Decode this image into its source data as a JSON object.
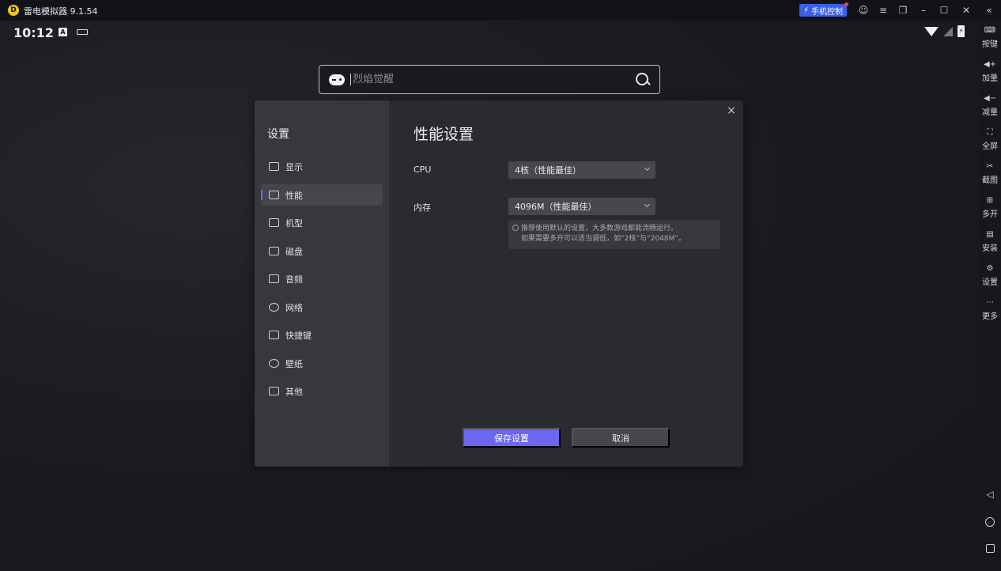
{
  "titlebar": {
    "app_title": "雷电模拟器 9.1.54",
    "logo_glyph": "D",
    "phone_control": "手机控制",
    "icons": [
      "user-icon",
      "menu-icon",
      "restore-icon",
      "minimize-icon",
      "maximize-icon",
      "close-icon",
      "collapse-icon"
    ]
  },
  "status": {
    "time": "10:12",
    "a_badge": "A",
    "battery_glyph": "⚡"
  },
  "search": {
    "placeholder": "烈焰觉醒"
  },
  "toolbar": {
    "items": [
      {
        "label": "按键",
        "icon": "keyboard-icon",
        "glyph": "⌨"
      },
      {
        "label": "加量",
        "icon": "volume-up-icon",
        "glyph": "◀+"
      },
      {
        "label": "减量",
        "icon": "volume-down-icon",
        "glyph": "◀−"
      },
      {
        "label": "全屏",
        "icon": "fullscreen-icon",
        "glyph": "⛶"
      },
      {
        "label": "截图",
        "icon": "screenshot-icon",
        "glyph": "✂"
      },
      {
        "label": "多开",
        "icon": "multi-instance-icon",
        "glyph": "⊞"
      },
      {
        "label": "安装",
        "icon": "install-icon",
        "glyph": "▤"
      },
      {
        "label": "设置",
        "icon": "settings-icon",
        "glyph": "⚙"
      },
      {
        "label": "更多",
        "icon": "more-icon",
        "glyph": "⋯"
      }
    ]
  },
  "dialog": {
    "heading": "设置",
    "title": "性能设置",
    "menu": [
      {
        "label": "显示",
        "icon": "display-icon",
        "active": false
      },
      {
        "label": "性能",
        "icon": "performance-icon",
        "active": true
      },
      {
        "label": "机型",
        "icon": "device-model-icon",
        "active": false
      },
      {
        "label": "磁盘",
        "icon": "disk-icon",
        "active": false
      },
      {
        "label": "音频",
        "icon": "audio-icon",
        "active": false
      },
      {
        "label": "网络",
        "icon": "network-icon",
        "active": false
      },
      {
        "label": "快捷键",
        "icon": "shortcut-icon",
        "active": false
      },
      {
        "label": "壁纸",
        "icon": "wallpaper-icon",
        "active": false
      },
      {
        "label": "其他",
        "icon": "other-icon",
        "active": false
      }
    ],
    "cpu_label": "CPU",
    "cpu_value": "4核（性能最佳）",
    "memory_label": "内存",
    "memory_value": "4096M（性能最佳）",
    "hint_line1": "推荐使用默认的设置，大多数游戏都能流畅运行。",
    "hint_line2": "如果需要多开可以适当调低，如“2核”与“2048M”。",
    "save_label": "保存设置",
    "cancel_label": "取消",
    "close_glyph": "×"
  },
  "colors": {
    "accent": "#6b67f0",
    "phone_control_bg": "#3a5fe8",
    "logo": "#f4c21a"
  }
}
